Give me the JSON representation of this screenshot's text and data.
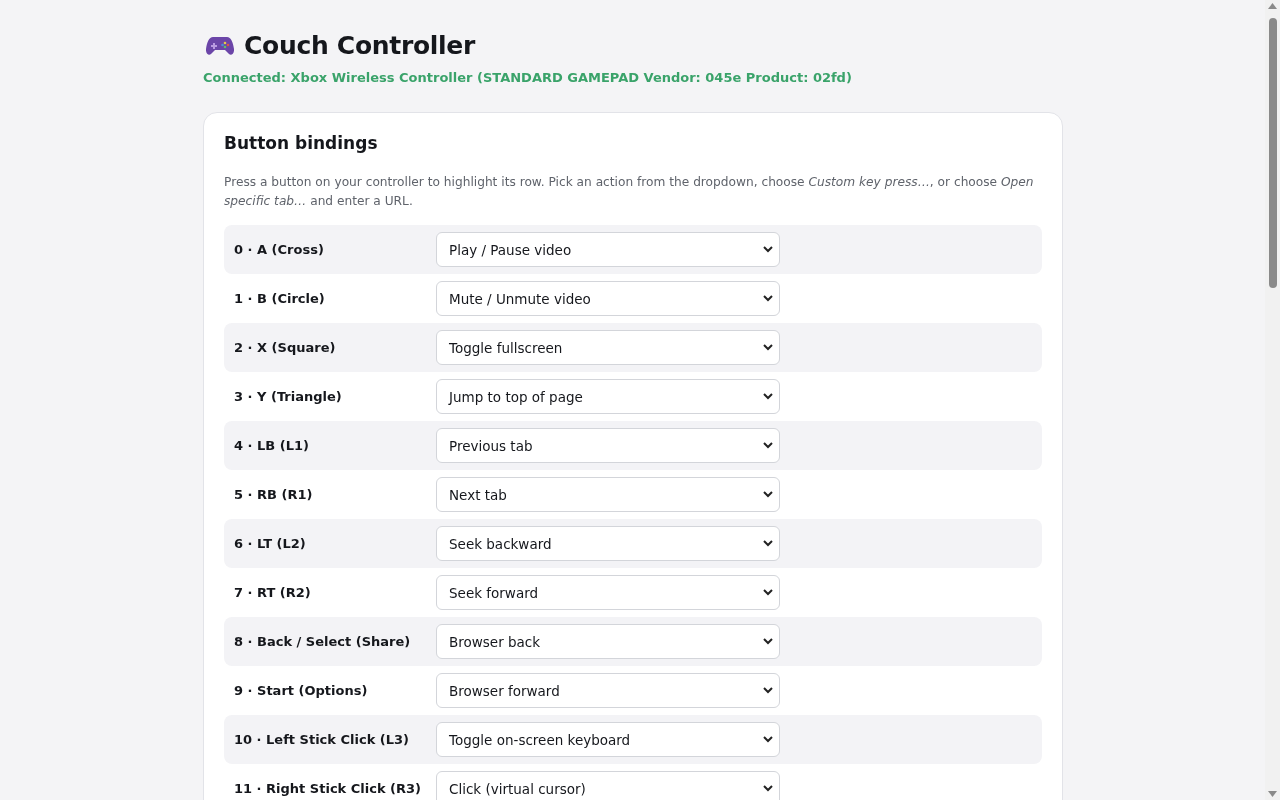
{
  "header": {
    "title": "Couch Controller",
    "status": "Connected: Xbox Wireless Controller (STANDARD GAMEPAD Vendor: 045e Product: 02fd)"
  },
  "bindings": {
    "title": "Button bindings",
    "description": "Press a button on your controller to highlight its row. Pick an action from the dropdown, choose *Custom key press…*, or choose *Open specific tab…* and enter a URL.",
    "rows": [
      {
        "button": "0 · A (Cross)",
        "action": "Play / Pause video"
      },
      {
        "button": "1 · B (Circle)",
        "action": "Mute / Unmute video"
      },
      {
        "button": "2 · X (Square)",
        "action": "Toggle fullscreen"
      },
      {
        "button": "3 · Y (Triangle)",
        "action": "Jump to top of page"
      },
      {
        "button": "4 · LB (L1)",
        "action": "Previous tab"
      },
      {
        "button": "5 · RB (R1)",
        "action": "Next tab"
      },
      {
        "button": "6 · LT (L2)",
        "action": "Seek backward"
      },
      {
        "button": "7 · RT (R2)",
        "action": "Seek forward"
      },
      {
        "button": "8 · Back / Select (Share)",
        "action": "Browser back"
      },
      {
        "button": "9 · Start (Options)",
        "action": "Browser forward"
      },
      {
        "button": "10 · Left Stick Click (L3)",
        "action": "Toggle on-screen keyboard"
      },
      {
        "button": "11 · Right Stick Click (R3)",
        "action": "Click (virtual cursor)"
      }
    ]
  }
}
